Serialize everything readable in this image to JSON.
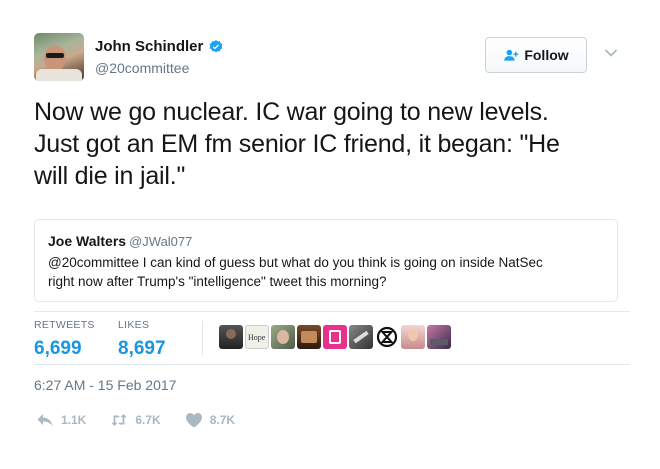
{
  "author": {
    "name": "John Schindler",
    "handle": "@20committee",
    "verified_icon": "verified-badge-icon"
  },
  "follow_button": {
    "label": "Follow",
    "icon": "follow-user-icon"
  },
  "tweet": {
    "lines": [
      "Now we go nuclear. IC war going to new levels.",
      "Just got an EM fm senior IC friend, it began: \"He",
      "will die in jail.\""
    ]
  },
  "quoted_tweet": {
    "name": "Joe Walters",
    "handle": "@JWal077",
    "lines": [
      "@20committee I can kind of guess but what do you think is going on inside NatSec",
      "right now after Trump's \"intelligence\" tweet this morning?"
    ]
  },
  "stats": {
    "retweets_label": "RETWEETS",
    "retweets_value": "6,699",
    "likes_label": "LIKES",
    "likes_value": "8,697"
  },
  "likers": [
    {
      "name": "liker-avatar-1",
      "color": "#3b3b3b",
      "label": ""
    },
    {
      "name": "liker-avatar-2",
      "color": "#f4f4f0",
      "label": "Hope"
    },
    {
      "name": "liker-avatar-3",
      "color": "#7a8a6e",
      "label": ""
    },
    {
      "name": "liker-avatar-4",
      "color": "#5a3a2a",
      "label": ""
    },
    {
      "name": "liker-avatar-5",
      "color": "#e8308c",
      "label": ""
    },
    {
      "name": "liker-avatar-6",
      "color": "#4a4a4a",
      "label": ""
    },
    {
      "name": "liker-avatar-7",
      "color": "#ffffff",
      "label": ""
    },
    {
      "name": "liker-avatar-8",
      "color": "#c98a8a",
      "label": ""
    },
    {
      "name": "liker-avatar-9",
      "color": "#6a3a5a",
      "label": ""
    }
  ],
  "timestamp": "6:27 AM - 15 Feb 2017",
  "actions": {
    "reply_count": "1.1K",
    "retweet_count": "6.7K",
    "like_count": "8.7K"
  },
  "colors": {
    "accent": "#1b95e0",
    "verified": "#1da1f2",
    "muted": "#657786",
    "action_gray": "#aab8c2"
  }
}
